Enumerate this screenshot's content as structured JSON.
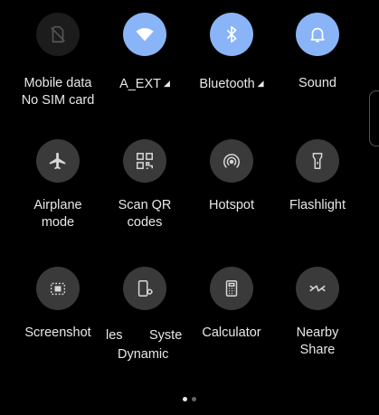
{
  "colors": {
    "tile_on": "#8ab4f8",
    "tile_off": "#3a3a3a",
    "tile_disabled": "#1c1c1c",
    "background": "#000000"
  },
  "tiles": [
    {
      "icon": "sim-off-icon",
      "line1": "Mobile data",
      "line2": "No SIM card",
      "state": "disabled"
    },
    {
      "icon": "wifi-icon",
      "line1": "A_EXT",
      "line2": "",
      "state": "on",
      "caret": "◢"
    },
    {
      "icon": "bluetooth-icon",
      "line1": "Bluetooth",
      "line2": "",
      "state": "on",
      "caret": "◢"
    },
    {
      "icon": "bell-icon",
      "line1": "Sound",
      "line2": "",
      "state": "on"
    },
    {
      "icon": "airplane-icon",
      "line1": "Airplane",
      "line2": "mode",
      "state": "off"
    },
    {
      "icon": "qr-code-icon",
      "line1": "Scan QR",
      "line2": "codes",
      "state": "off"
    },
    {
      "icon": "hotspot-icon",
      "line1": "Hotspot",
      "line2": "",
      "state": "off"
    },
    {
      "icon": "flashlight-icon",
      "line1": "Flashlight",
      "line2": "",
      "state": "off"
    },
    {
      "icon": "screenshot-icon",
      "line1": "Screenshot",
      "line2": "",
      "state": "off"
    },
    {
      "icon": "dynamic-system-icon",
      "line1a": "les",
      "line1b": "Syste",
      "line2": "Dynamic",
      "state": "off"
    },
    {
      "icon": "calculator-icon",
      "line1": "Calculator",
      "line2": "",
      "state": "off"
    },
    {
      "icon": "nearby-share-icon",
      "line1": "Nearby",
      "line2": "Share",
      "state": "off"
    }
  ],
  "pager": {
    "pages": 2,
    "current": 1
  }
}
